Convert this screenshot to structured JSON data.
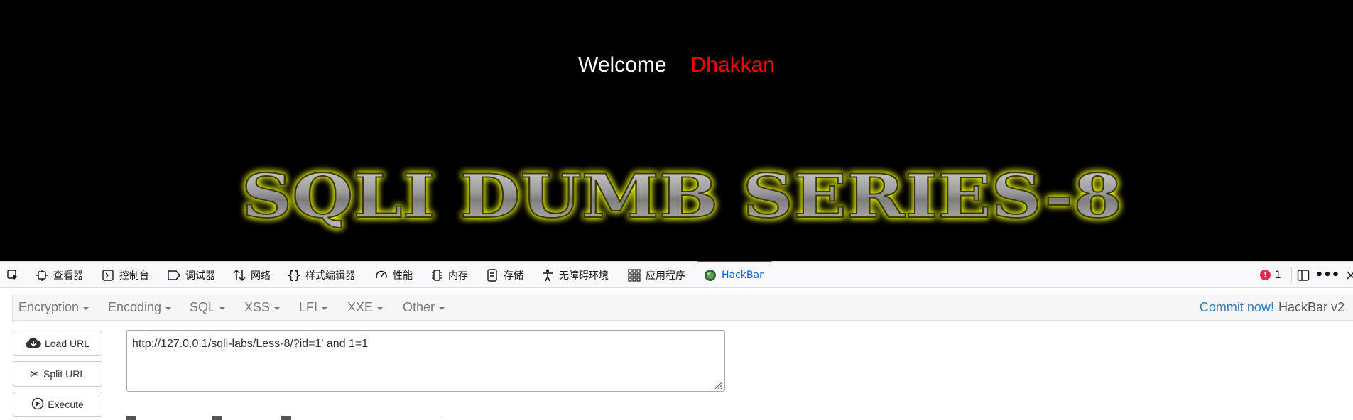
{
  "page": {
    "welcome": "Welcome",
    "name": "Dhakkan",
    "banner": "SQLI DUMB SERIES-8"
  },
  "devtools": {
    "tabs": [
      {
        "label": "查看器",
        "icon": "inspector-icon"
      },
      {
        "label": "控制台",
        "icon": "console-icon"
      },
      {
        "label": "调试器",
        "icon": "debugger-icon"
      },
      {
        "label": "网络",
        "icon": "network-icon"
      },
      {
        "label": "样式编辑器",
        "icon": "style-editor-icon"
      },
      {
        "label": "性能",
        "icon": "performance-icon"
      },
      {
        "label": "内存",
        "icon": "memory-icon"
      },
      {
        "label": "存储",
        "icon": "storage-icon"
      },
      {
        "label": "无障碍环境",
        "icon": "accessibility-icon"
      },
      {
        "label": "应用程序",
        "icon": "application-icon"
      },
      {
        "label": "HackBar",
        "icon": "hackbar-icon"
      }
    ],
    "error_count": "1"
  },
  "hackbar": {
    "menus": [
      "Encryption",
      "Encoding",
      "SQL",
      "XSS",
      "LFI",
      "XXE",
      "Other"
    ],
    "commit": "Commit now!",
    "version": "HackBar v2",
    "buttons": {
      "load": "Load URL",
      "split": "Split URL",
      "execute": "Execute"
    },
    "url": "http://127.0.0.1/sqli-labs/Less-8/?id=1' and 1=1"
  },
  "colors": {
    "accent": "#0061e0",
    "name": "#ff0000",
    "glow": "#e6f000",
    "error": "#e22850"
  }
}
